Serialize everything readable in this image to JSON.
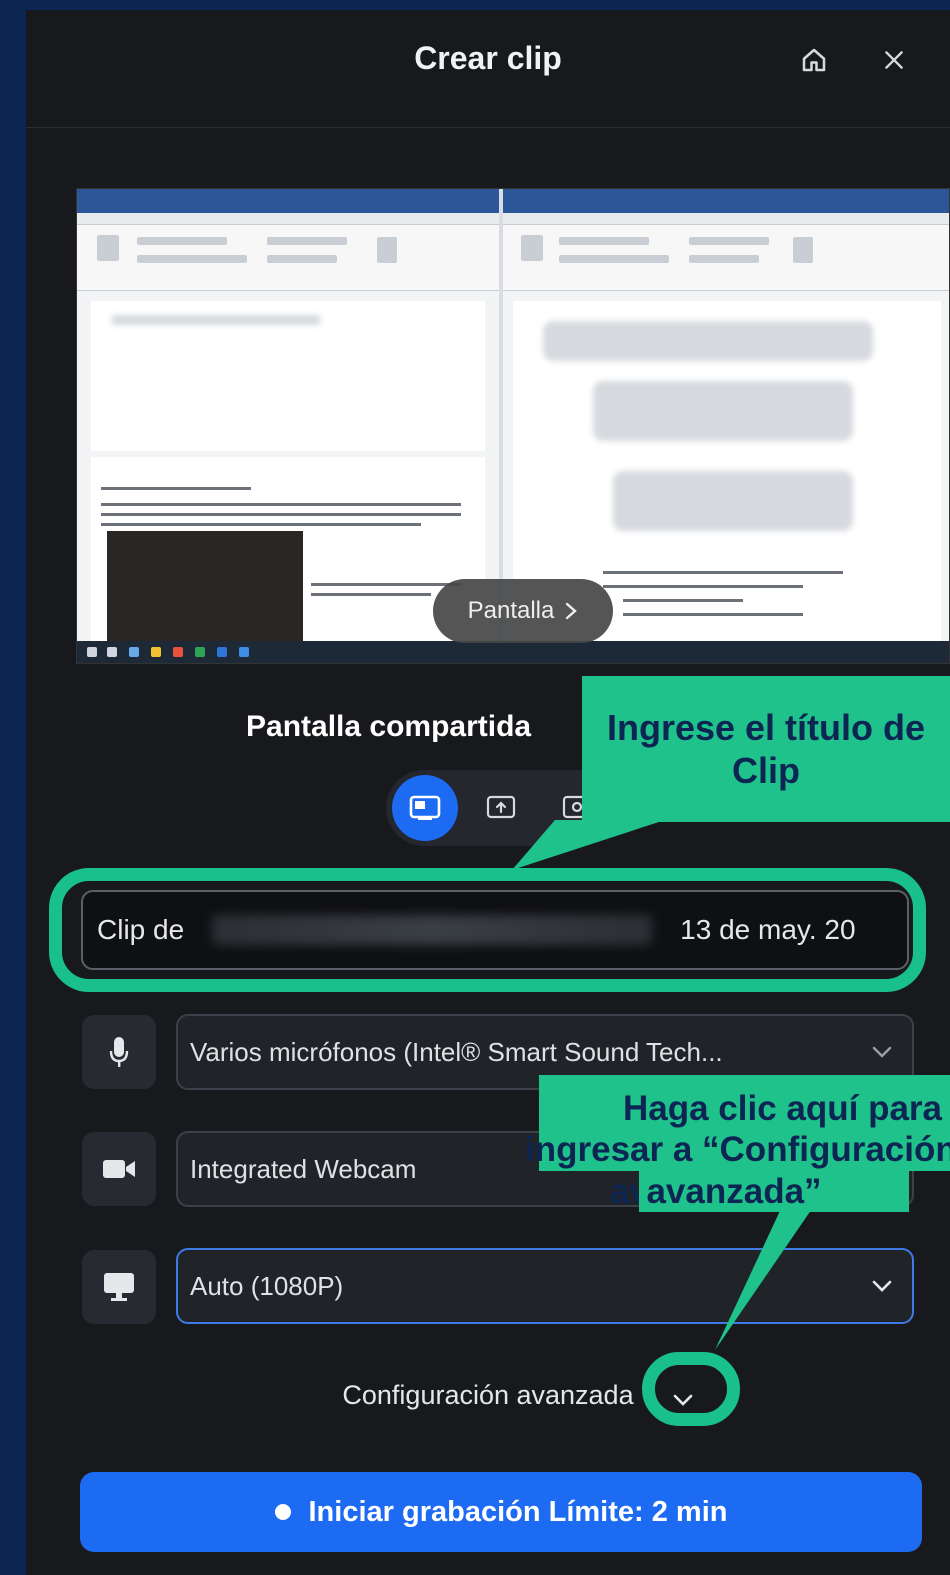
{
  "window": {
    "title": "Crear clip"
  },
  "preview": {
    "screen_label": "Pantalla"
  },
  "source": {
    "label": "Pantalla compartida"
  },
  "clip_title": {
    "prefix": "Clip de",
    "suffix": "13 de may. 20"
  },
  "microphone": {
    "value": "Varios micrófonos (Intel® Smart Sound Tech..."
  },
  "camera": {
    "value": "Integrated Webcam"
  },
  "resolution": {
    "value": "Auto (1080P)"
  },
  "advanced": {
    "label": "Configuración avanzada"
  },
  "record": {
    "label": "Iniciar grabación Límite: 2 min"
  },
  "annotations": {
    "title_callout": {
      "line1": "Ingrese el título de",
      "line2": "Clip"
    },
    "advanced_callout": {
      "line1": "Haga clic aquí para",
      "line2": "ingresar a “Configuración",
      "line3": "avanzada”"
    }
  },
  "colors": {
    "accent": "#1c6bf2",
    "annotation": "#1fc28a",
    "background": "#0d2552"
  }
}
